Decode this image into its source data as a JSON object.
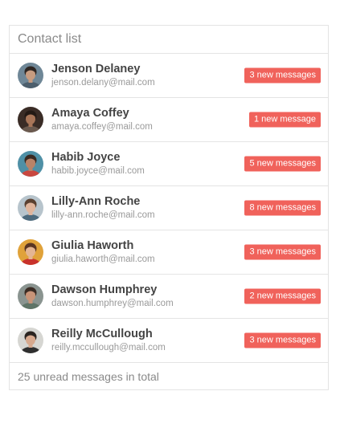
{
  "header": {
    "title": "Contact list"
  },
  "contacts": [
    {
      "name": "Jenson Delaney",
      "email": "jenson.delany@mail.com",
      "badge": "3 new messages",
      "avatar_icon": "person-photo-icon",
      "avatar_colors": {
        "bg": "#6f8797",
        "hair": "#2e2622",
        "skin": "#c79c80",
        "shirt": "#4d5f6d"
      }
    },
    {
      "name": "Amaya Coffey",
      "email": "amaya.coffey@mail.com",
      "badge": "1 new message",
      "avatar_icon": "person-photo-icon",
      "avatar_colors": {
        "bg": "#3a2c26",
        "hair": "#241a15",
        "skin": "#a87558",
        "shirt": "#6b5a4f"
      }
    },
    {
      "name": "Habib Joyce",
      "email": "habib.joyce@mail.com",
      "badge": "5 new messages",
      "avatar_icon": "person-photo-icon",
      "avatar_colors": {
        "bg": "#4f90a6",
        "hair": "#3a2a22",
        "skin": "#b98368",
        "shirt": "#c9473f"
      }
    },
    {
      "name": "Lilly-Ann Roche",
      "email": "lilly-ann.roche@mail.com",
      "badge": "8 new messages",
      "avatar_icon": "person-photo-icon",
      "avatar_colors": {
        "bg": "#b7c4cc",
        "hair": "#5a4030",
        "skin": "#e0b59c",
        "shirt": "#4d6a7d"
      }
    },
    {
      "name": "Giulia Haworth",
      "email": "giulia.haworth@mail.com",
      "badge": "3 new messages",
      "avatar_icon": "person-photo-icon",
      "avatar_colors": {
        "bg": "#e0a23a",
        "hair": "#5a3522",
        "skin": "#e4b592",
        "shirt": "#c8322c"
      }
    },
    {
      "name": "Dawson Humphrey",
      "email": "dawson.humphrey@mail.com",
      "badge": "2 new messages",
      "avatar_icon": "person-photo-icon",
      "avatar_colors": {
        "bg": "#8a9490",
        "hair": "#3b2c24",
        "skin": "#c89478",
        "shirt": "#5f7467"
      }
    },
    {
      "name": "Reilly McCullough",
      "email": "reilly.mccullough@mail.com",
      "badge": "3 new messages",
      "avatar_icon": "person-photo-icon",
      "avatar_colors": {
        "bg": "#d6d6d2",
        "hair": "#2a2420",
        "skin": "#d7a98e",
        "shirt": "#2f2f2f"
      }
    }
  ],
  "footer": {
    "summary": "25 unread messages in total"
  },
  "colors": {
    "badge": "#f0625b",
    "border": "#e4e4e4",
    "name_text": "#444444",
    "muted_text": "#9a9a9a"
  }
}
